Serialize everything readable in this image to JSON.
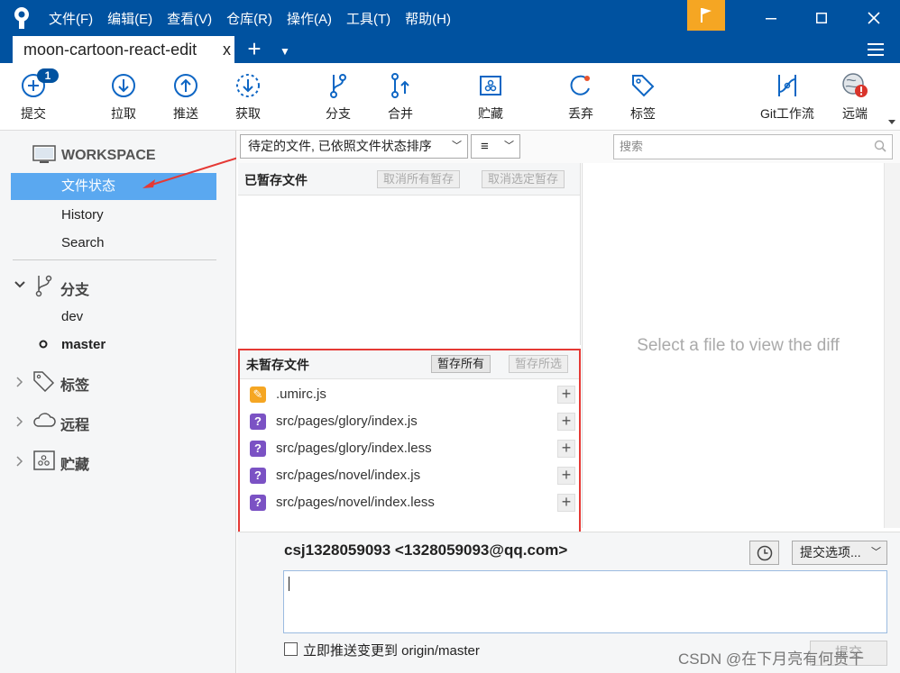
{
  "menu": [
    "文件(F)",
    "编辑(E)",
    "查看(V)",
    "仓库(R)",
    "操作(A)",
    "工具(T)",
    "帮助(H)"
  ],
  "window": {
    "minimize_icon": "minimize-icon",
    "maximize_icon": "maximize-icon",
    "close_icon": "close-icon"
  },
  "tab": {
    "title": "moon-cartoon-react-edit",
    "close": "x",
    "add": "+",
    "dropdown": "▼"
  },
  "toolbar": {
    "commit": "提交",
    "commit_badge": "1",
    "pull": "拉取",
    "push": "推送",
    "fetch": "获取",
    "branch": "分支",
    "merge": "合并",
    "stash": "贮藏",
    "discard": "丢弃",
    "tag": "标签",
    "gitflow": "Git工作流",
    "remote": "远端"
  },
  "sidebar": {
    "workspace": "WORKSPACE",
    "file_status": "文件状态",
    "history": "History",
    "search": "Search",
    "branches_header": "分支",
    "branches": [
      "dev",
      "master"
    ],
    "current_branch": "master",
    "tags_header": "标签",
    "remotes_header": "远程",
    "stashes_header": "贮藏"
  },
  "filter": {
    "sort_label": "待定的文件, 已依照文件状态排序",
    "view_icon": "≡",
    "search_placeholder": "搜索"
  },
  "staged": {
    "title": "已暂存文件",
    "unstage_all": "取消所有暂存",
    "unstage_selected": "取消选定暂存"
  },
  "unstaged": {
    "title": "未暂存文件",
    "stage_all": "暂存所有",
    "stage_selected": "暂存所选",
    "files": [
      {
        "name": ".umirc.js",
        "status": "modified"
      },
      {
        "name": "src/pages/glory/index.js",
        "status": "untracked"
      },
      {
        "name": "src/pages/glory/index.less",
        "status": "untracked"
      },
      {
        "name": "src/pages/novel/index.js",
        "status": "untracked"
      },
      {
        "name": "src/pages/novel/index.less",
        "status": "untracked"
      }
    ]
  },
  "diff": {
    "placeholder": "Select a file to view the diff"
  },
  "commit": {
    "author": "csj1328059093 <1328059093@qq.com>",
    "options": "提交选项...",
    "push_label": "立即推送变更到 origin/master",
    "submit": "提交"
  },
  "watermark": "CSDN @在下月亮有何贵干",
  "colors": {
    "titlebar": "#0052a0",
    "selection": "#5aa8f0",
    "modified": "#f5a623",
    "untracked": "#7b52c4",
    "highlight_border": "#e53935"
  }
}
